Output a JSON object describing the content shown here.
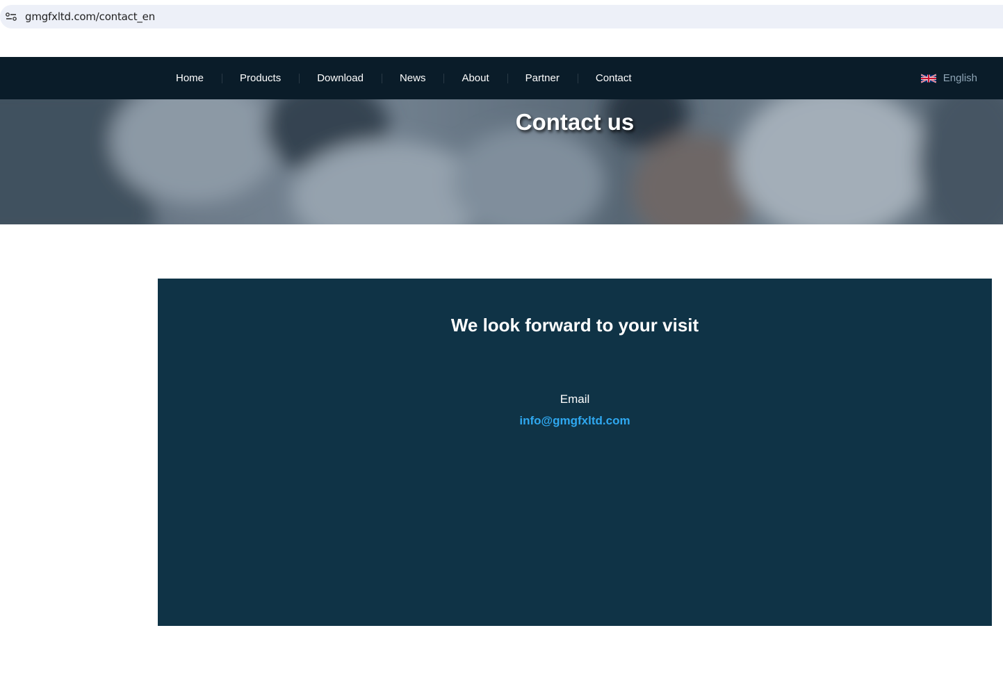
{
  "browser": {
    "url": "gmgfxltd.com/contact_en",
    "site_info_icon": "site-settings-icon"
  },
  "nav": {
    "items": [
      {
        "label": "Home"
      },
      {
        "label": "Products"
      },
      {
        "label": "Download"
      },
      {
        "label": "News"
      },
      {
        "label": "About"
      },
      {
        "label": "Partner"
      },
      {
        "label": "Contact"
      }
    ],
    "language": {
      "label": "English",
      "icon": "uk-flag-icon"
    }
  },
  "hero": {
    "title": "Contact us"
  },
  "contact": {
    "title": "We look forward to your visit",
    "email_label": "Email",
    "email_value": "info@gmgfxltd.com"
  },
  "colors": {
    "nav_bg": "#0a1c29",
    "card_bg": "#0f3346",
    "link": "#2fa8f0",
    "address_bar_bg": "#edf0f8"
  }
}
